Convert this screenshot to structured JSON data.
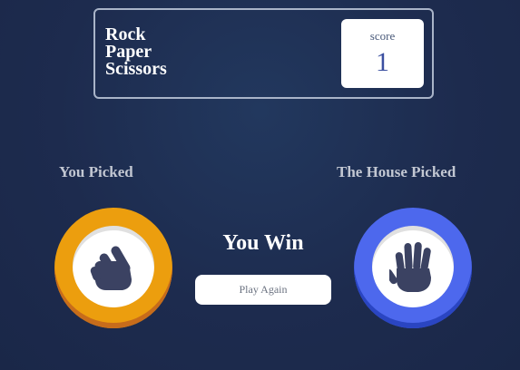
{
  "header": {
    "title_lines": [
      "Rock",
      "Paper",
      "Scissors"
    ],
    "score_label": "score",
    "score_value": "1"
  },
  "player": {
    "label": "You Picked",
    "pick_icon": "scissors-hand-icon",
    "token_color": "#ec9e0e"
  },
  "house": {
    "label": "The House Picked",
    "pick_icon": "paper-hand-icon",
    "token_color": "#4d68ed"
  },
  "result": {
    "text": "You Win",
    "button_label": "Play Again"
  },
  "colors": {
    "background": "#1d2b4e",
    "hand_icon": "#3b4262"
  }
}
